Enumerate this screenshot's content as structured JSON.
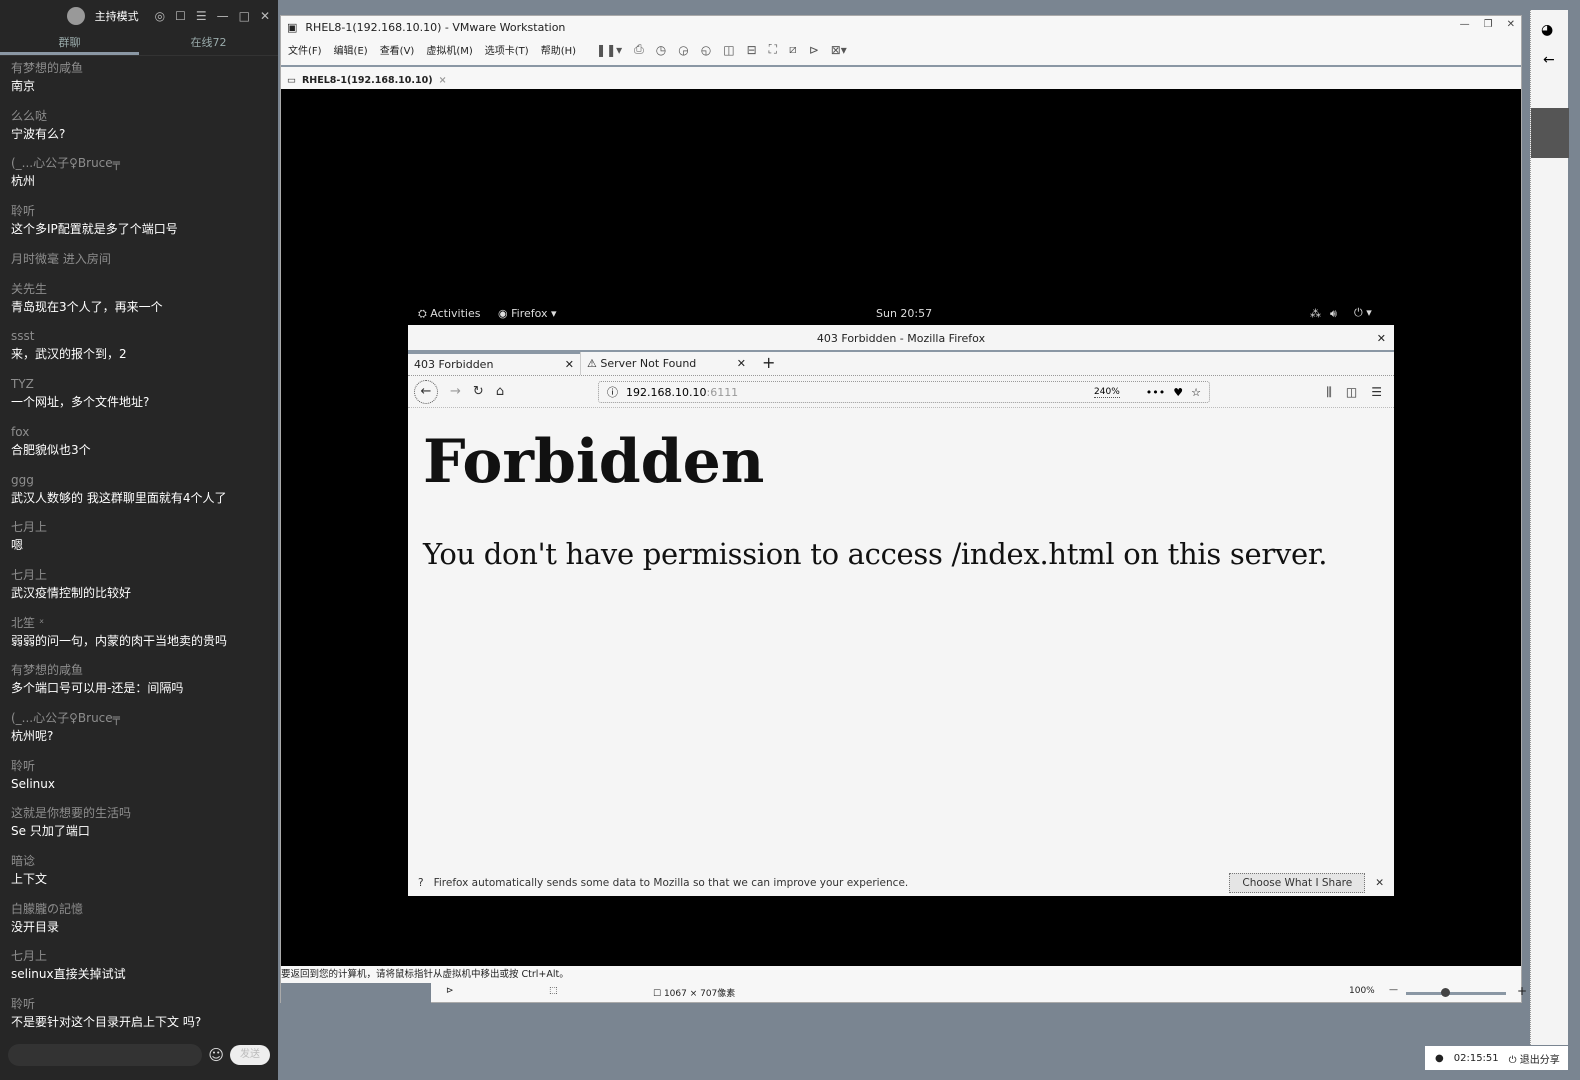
{
  "chat": {
    "header_title": "主持模式",
    "tabs": [
      "群聊",
      "在线72"
    ],
    "messages": [
      {
        "name": "有梦想的咸鱼",
        "text": "南京"
      },
      {
        "name": "么么哒",
        "text": "宁波有么?"
      },
      {
        "name": "(_...心公子♀Bruce╤",
        "text": "杭州"
      },
      {
        "name": "聆听",
        "text": "这个多IP配置就是多了个端口号"
      },
      {
        "system": "月时微毫 进入房间"
      },
      {
        "name": "关先生",
        "text": "青岛现在3个人了，再来一个"
      },
      {
        "name": "ssst",
        "text": "来，武汉的报个到，2"
      },
      {
        "name": "TYZ",
        "text": "一个网址，多个文件地址?"
      },
      {
        "name": "fox",
        "text": "合肥貌似也3个"
      },
      {
        "name": "ggg",
        "text": "武汉人数够的  我这群聊里面就有4个人了"
      },
      {
        "name": "七月上",
        "text": "嗯"
      },
      {
        "name": "七月上",
        "text": "武汉疫情控制的比较好"
      },
      {
        "name": "北笙 ˣ",
        "text": "弱弱的问一句，内蒙的肉干当地卖的贵吗"
      },
      {
        "name": "有梦想的咸鱼",
        "text": "多个端口号可以用-还是：间隔吗"
      },
      {
        "name": "(_...心公子♀Bruce╤",
        "text": "杭州呢?"
      },
      {
        "name": "聆听",
        "text": "Selinux"
      },
      {
        "name": "这就是你想要的生活吗",
        "text": "Se 只加了端口"
      },
      {
        "name": "暗谂",
        "text": "上下文"
      },
      {
        "name": "白朦朧の記憶",
        "text": "没开目录"
      },
      {
        "name": "七月上",
        "text": "selinux直接关掉试试"
      },
      {
        "name": "聆听",
        "text": "不是要针对这个目录开启上下文 吗?"
      }
    ],
    "send_label": "发送"
  },
  "vmware": {
    "title": "RHEL8-1(192.168.10.10) - VMware Workstation",
    "menu": [
      "文件(F)",
      "编辑(E)",
      "查看(V)",
      "虚拟机(M)",
      "选项卡(T)",
      "帮助(H)"
    ],
    "tab": "RHEL8-1(192.168.10.10)",
    "status_hint": "要返回到您的计算机，请将鼠标指针从虚拟机中移出或按 Ctrl+Alt。",
    "dimensions": "1067 × 707像素",
    "zoom": "100%"
  },
  "gnome": {
    "activities": "Activities",
    "app": "Firefox",
    "clock": "Sun 20:57"
  },
  "firefox": {
    "window_title": "403 Forbidden - Mozilla Firefox",
    "tabs": [
      {
        "label": "403 Forbidden",
        "active": true
      },
      {
        "label": "Server Not Found",
        "active": false
      }
    ],
    "url_host": "192.168.10.10",
    "url_port": ":6111",
    "zoom": "240%",
    "heading": "Forbidden",
    "message": "You don't have permission to access /index.html on this server.",
    "notification": "Firefox automatically sends some data to Mozilla so that we can improve your experience.",
    "choose_label": "Choose What I Share"
  },
  "share": {
    "timer": "02:15:51",
    "exit_label": "退出分享"
  }
}
